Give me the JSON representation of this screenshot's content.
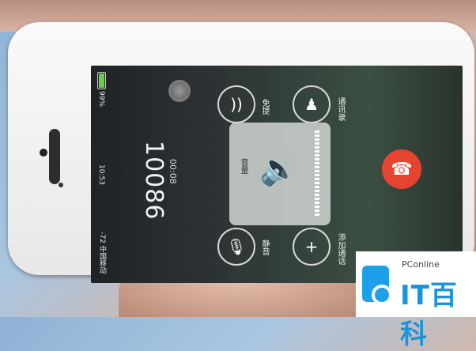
{
  "status": {
    "carrier": "-72 中国移动",
    "time": "10:53",
    "battery": "99%",
    "battery_level": 0.99
  },
  "call": {
    "number": "10086",
    "duration": "00:08"
  },
  "controls": {
    "speaker_label": "免提",
    "contacts_label": "通讯录",
    "volume_label": "音量",
    "mute_label": "静音",
    "add_call_label": "添加通话"
  },
  "volume_hud": {
    "level": 0.85
  },
  "watermark": {
    "small_text": "PConline",
    "big_text": "IT百科"
  },
  "colors": {
    "end_call": "#e64331",
    "battery_fill": "#6ad04a",
    "brand": "#1a94dd"
  }
}
